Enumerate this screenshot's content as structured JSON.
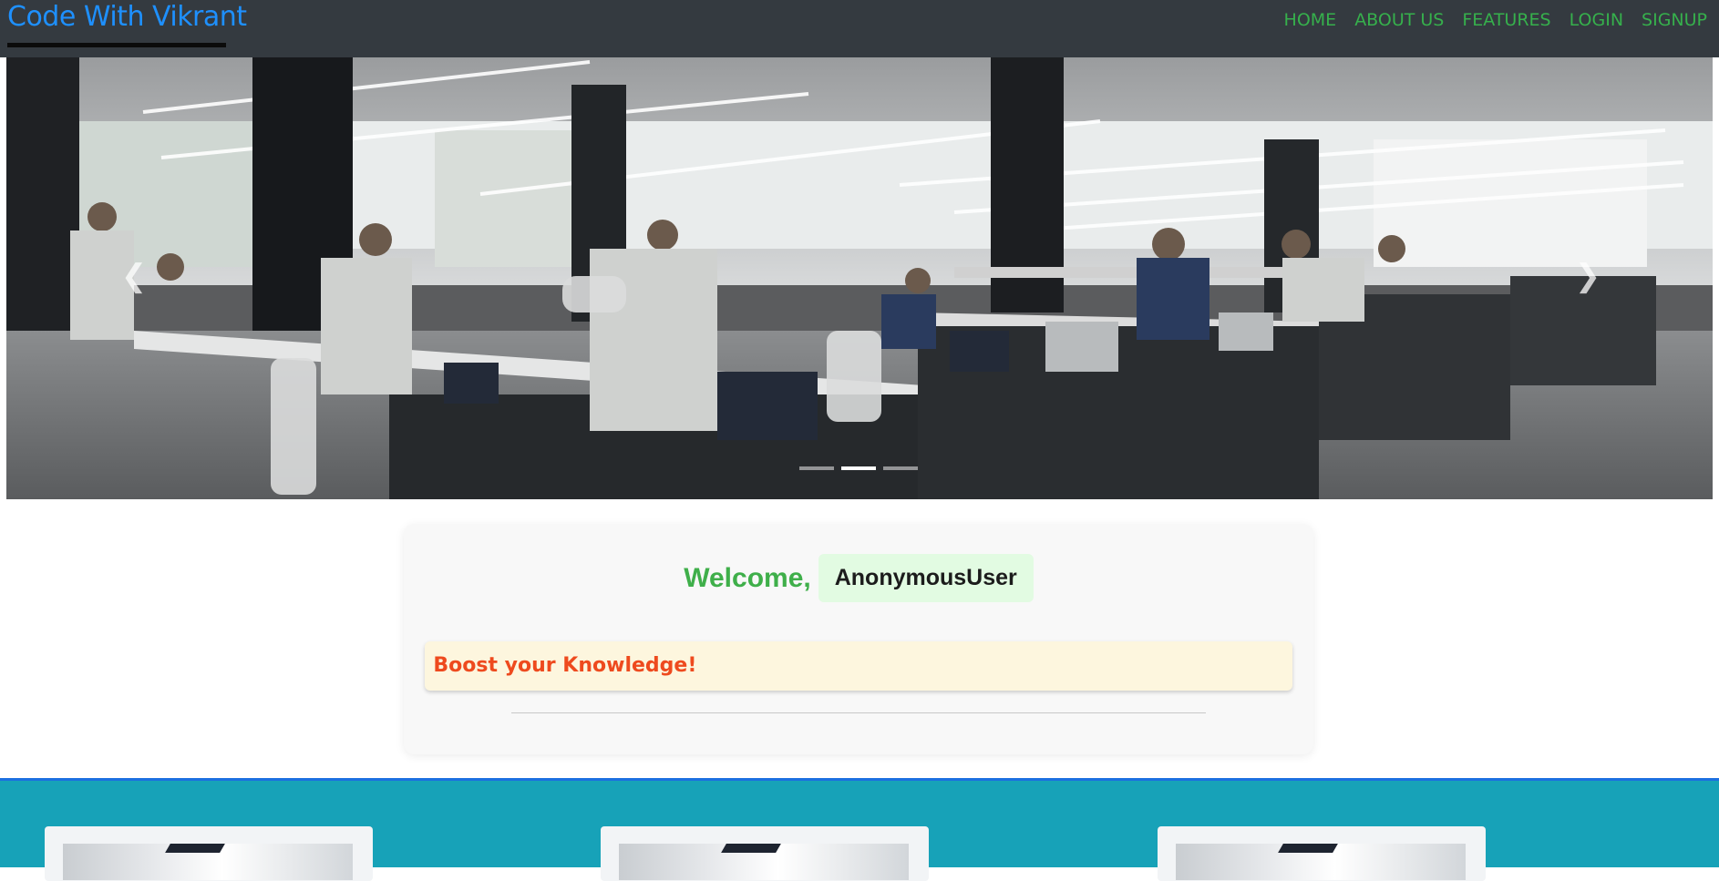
{
  "navbar": {
    "brand": "Code With Vikrant",
    "links": [
      "HOME",
      "ABOUT US",
      "FEATURES",
      "LOGIN",
      "SIGNUP"
    ]
  },
  "carousel": {
    "prev_icon": "chevron-left-icon",
    "next_icon": "chevron-right-icon",
    "slide_count": 3,
    "active_slide": 2
  },
  "welcome": {
    "greeting": "Welcome,",
    "username": "AnonymousUser",
    "marquee": "d Boost your Knowledge!"
  },
  "colors": {
    "navbar_bg": "#343a40",
    "brand": "#1e90ff",
    "nav_link": "#36b04c",
    "greeting": "#3faf4a",
    "marquee_text": "#ee4a1e",
    "features_bg": "#17a2b8"
  }
}
